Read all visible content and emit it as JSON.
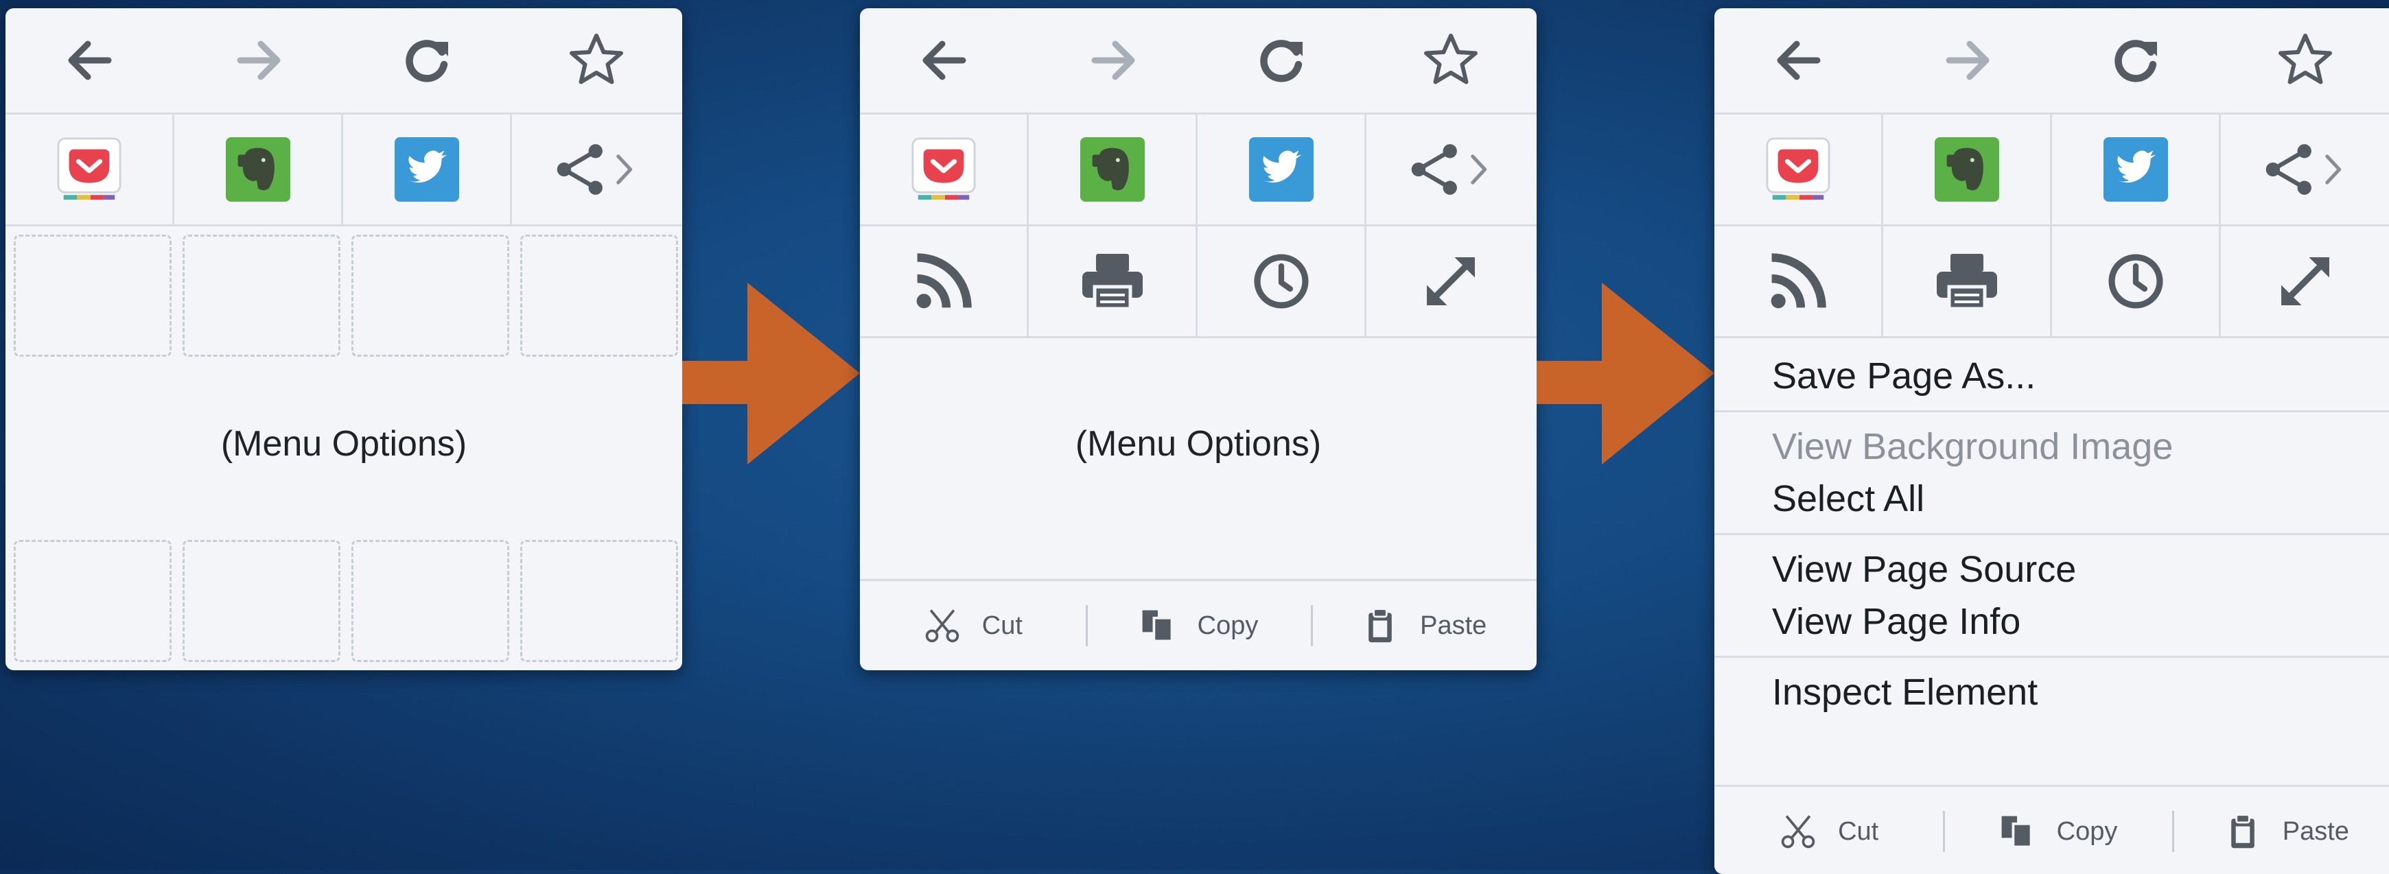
{
  "nav": {
    "back_icon": "back-arrow-icon",
    "forward_icon": "forward-arrow-icon",
    "reload_icon": "reload-icon",
    "bookmark_icon": "star-icon"
  },
  "share_row": [
    "pocket-icon",
    "evernote-icon",
    "twitter-icon",
    "share-icon"
  ],
  "tool_row": [
    "rss-icon",
    "print-icon",
    "history-clock-icon",
    "fullscreen-icon"
  ],
  "menu_options_label": "(Menu Options)",
  "edit": {
    "cut": "Cut",
    "copy": "Copy",
    "paste": "Paste"
  },
  "menu_groups": [
    [
      {
        "label": "Save Page As...",
        "enabled": true
      }
    ],
    [
      {
        "label": "View Background Image",
        "enabled": false
      },
      {
        "label": "Select All",
        "enabled": true
      }
    ],
    [
      {
        "label": "View Page Source",
        "enabled": true
      },
      {
        "label": "View Page Info",
        "enabled": true
      }
    ],
    [
      {
        "label": "Inspect Element",
        "enabled": true
      }
    ]
  ],
  "colors": {
    "background": "#154a82",
    "panel": "#f3f5f9",
    "arrow": "#c8642a",
    "pocket": "#e8424f",
    "evernote": "#5bb046",
    "twitter": "#3a9ad8"
  }
}
